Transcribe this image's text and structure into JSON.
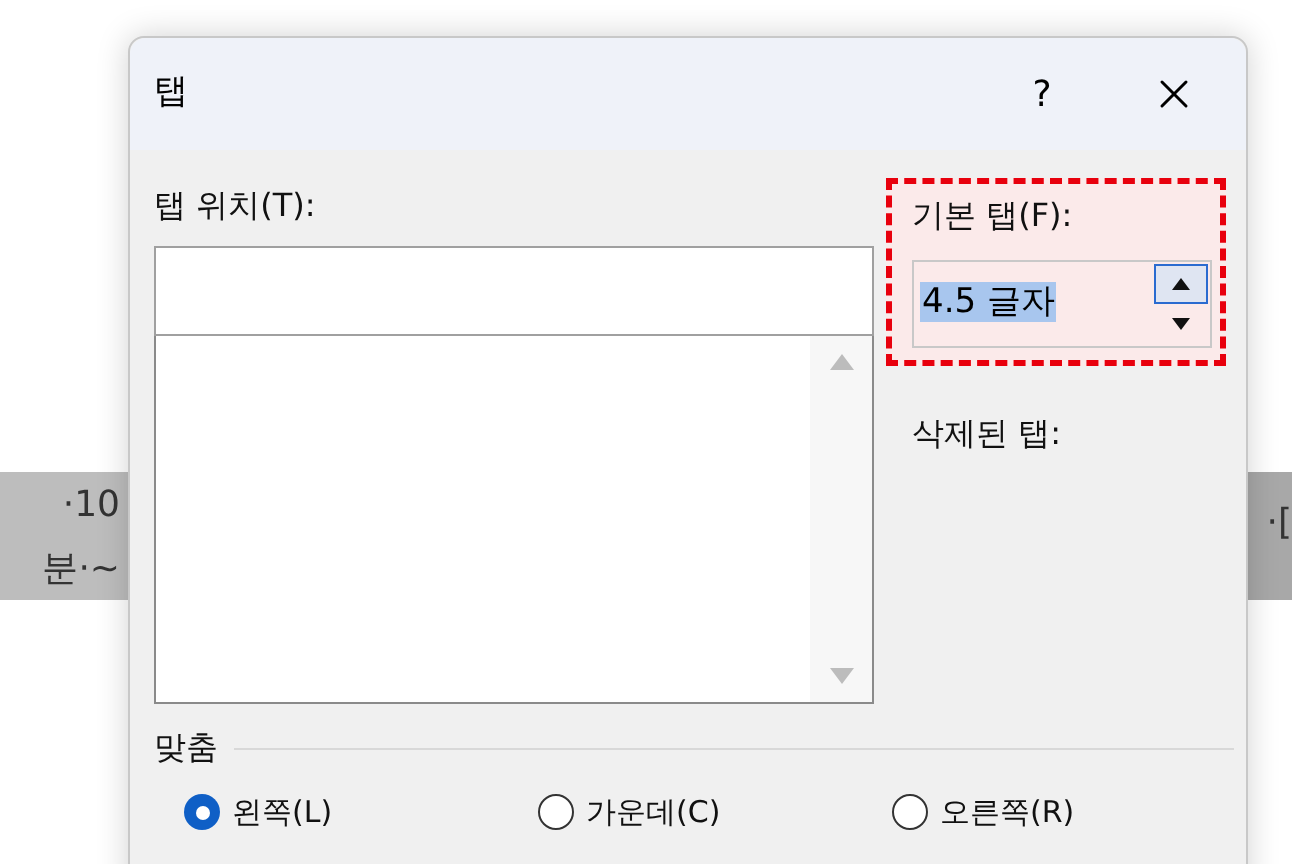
{
  "document": {
    "left_lines": [
      "·10",
      "분·~"
    ],
    "right_lines": [
      "·["
    ]
  },
  "dialog": {
    "title": "탭",
    "help": "?",
    "tab_position": {
      "label": "탭 위치(T):"
    },
    "default_tab": {
      "label": "기본 탭(F):",
      "value": "4.5 글자",
      "highlighted": true
    },
    "cleared_label": "삭제된 탭:",
    "alignment": {
      "label": "맞춤",
      "options": [
        {
          "label": "왼쪽(L)",
          "selected": true
        },
        {
          "label": "가운데(C)",
          "selected": false
        },
        {
          "label": "오른쪽(R)",
          "selected": false
        }
      ]
    }
  }
}
